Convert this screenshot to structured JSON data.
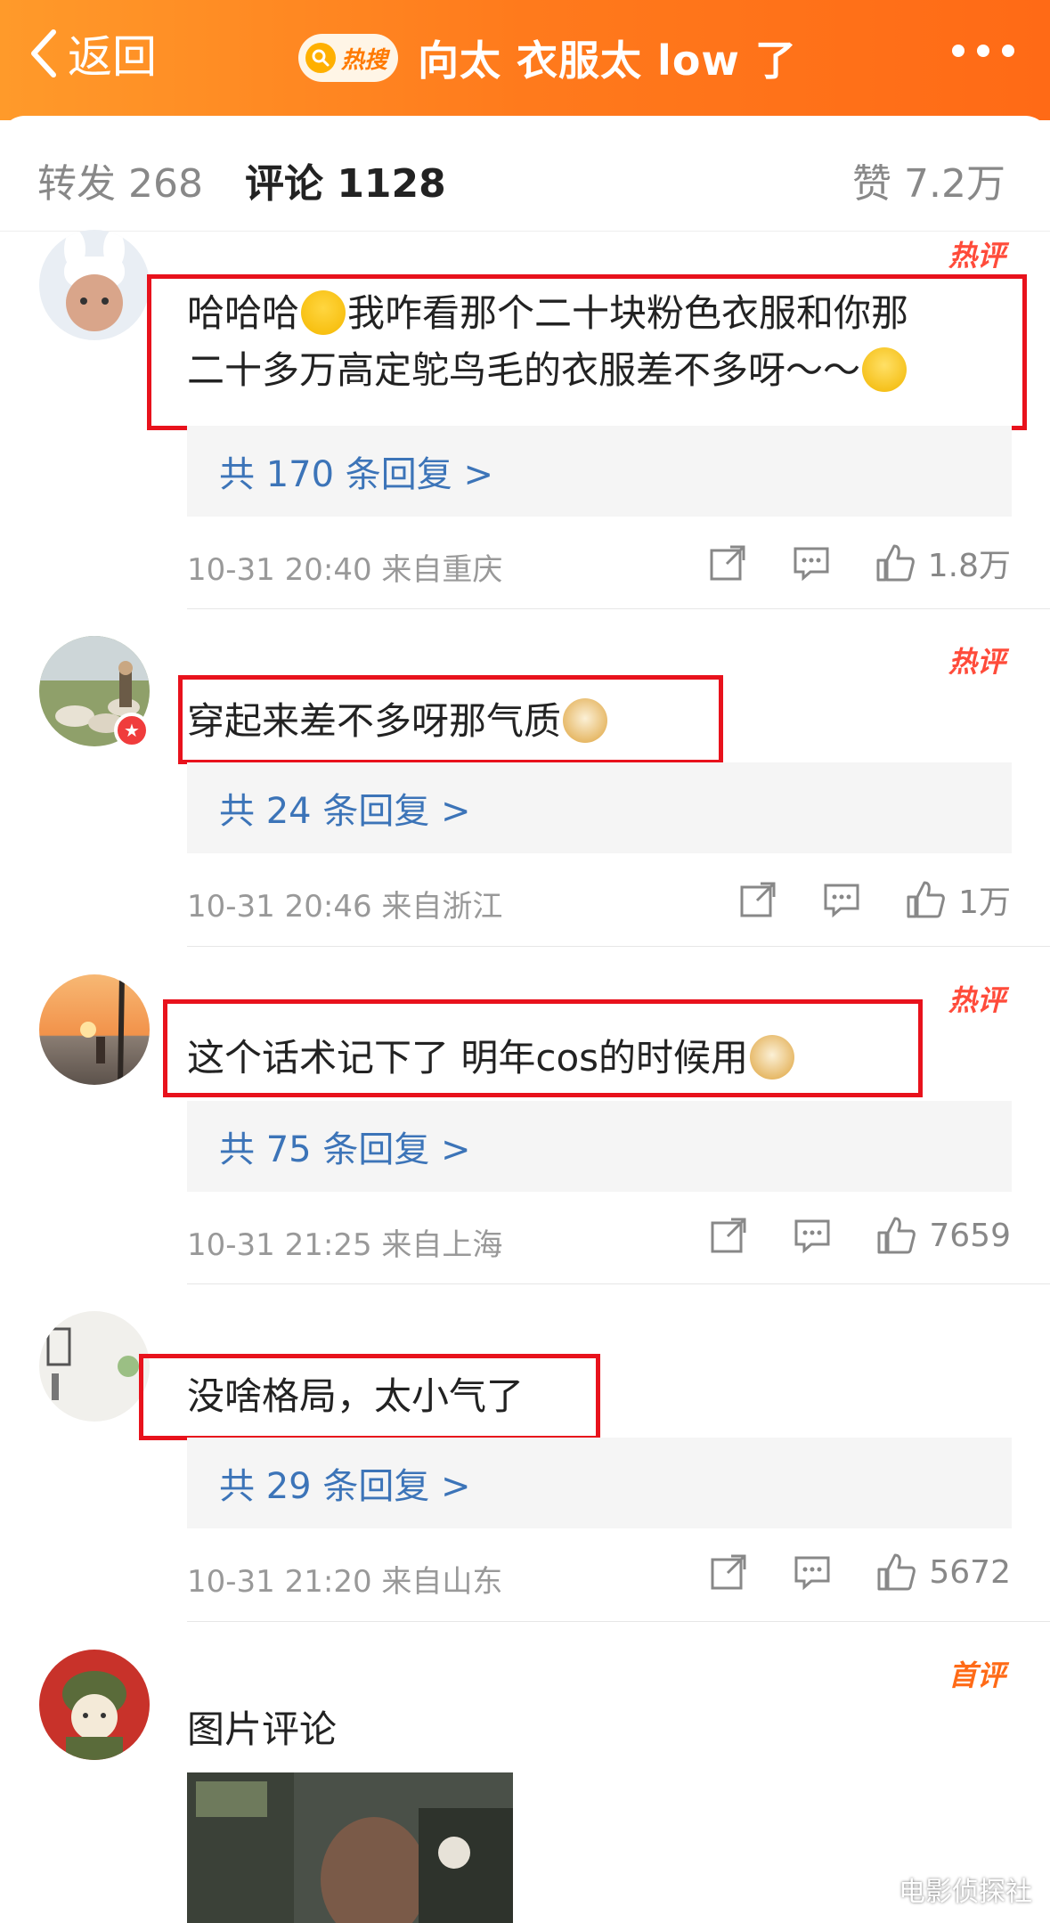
{
  "header": {
    "back_label": "返回",
    "hot_search_label": "热搜",
    "title": "向太 衣服太 low 了",
    "colors": {
      "accent": "#ff7a1c",
      "link": "#3c74b8",
      "hot_tag": "#ff4b3a",
      "highlight_box": "#e8121c"
    }
  },
  "tabs": {
    "repost": "转发 268",
    "comments": "评论 1128",
    "likes": "赞 7.2万"
  },
  "comments": [
    {
      "tag": "热评",
      "text_line1": "哈哈哈",
      "text_line1b": "我咋看那个二十块粉色衣服和你那",
      "text_line2": "二十多万高定鸵鸟毛的衣服差不多呀～～",
      "replies": "共 170 条回复 >",
      "meta": "10-31 20:40  来自重庆",
      "likes": "1.8万"
    },
    {
      "tag": "热评",
      "text": "穿起来差不多呀那气质",
      "replies": "共 24 条回复 >",
      "meta": "10-31 20:46  来自浙江",
      "likes": "1万"
    },
    {
      "tag": "热评",
      "text": "这个话术记下了 明年cos的时候用",
      "replies": "共 75 条回复 >",
      "meta": "10-31 21:25  来自上海",
      "likes": "7659"
    },
    {
      "text": "没啥格局，太小气了",
      "replies": "共 29 条回复 >",
      "meta": "10-31 21:20  来自山东",
      "likes": "5672"
    },
    {
      "tag": "首评",
      "text": "图片评论"
    }
  ],
  "watermark": "电影侦探社"
}
